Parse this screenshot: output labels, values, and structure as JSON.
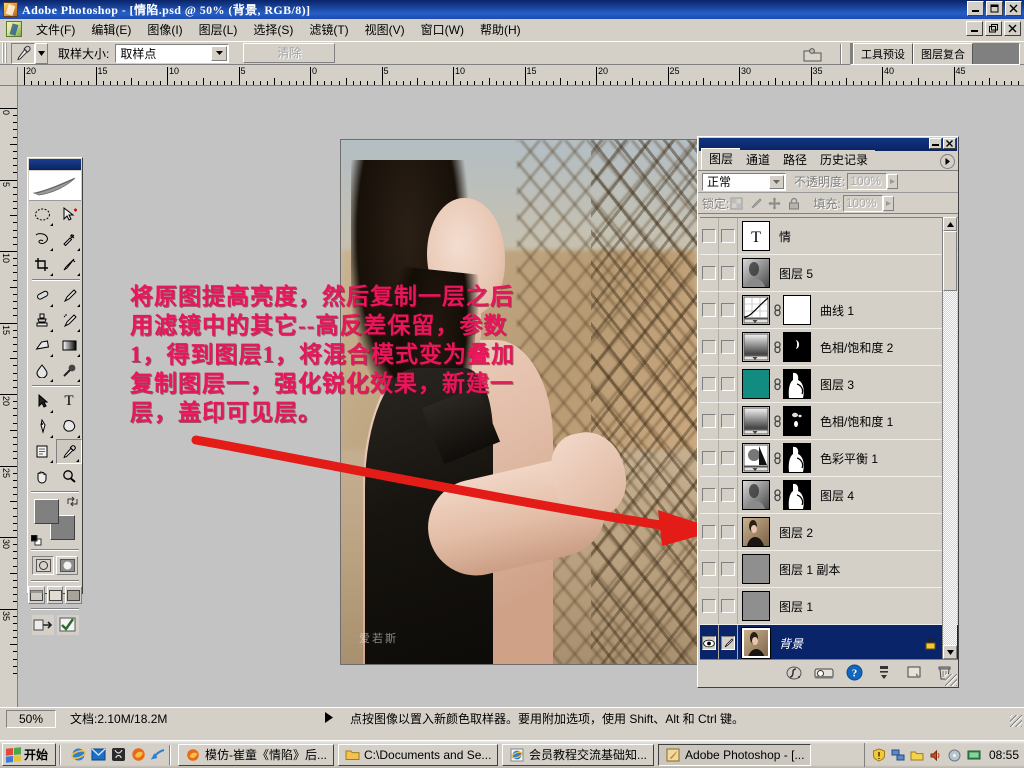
{
  "window": {
    "app_title": "Adobe Photoshop - [情陷.psd @ 50%  (背景,  RGB/8)]",
    "app_icon": "photoshop-icon",
    "minimize": "minimize-icon",
    "maximize": "maximize-icon",
    "close": "close-icon"
  },
  "menubar": {
    "items": [
      {
        "label": "文件(F)"
      },
      {
        "label": "编辑(E)"
      },
      {
        "label": "图像(I)"
      },
      {
        "label": "图层(L)"
      },
      {
        "label": "选择(S)"
      },
      {
        "label": "滤镜(T)"
      },
      {
        "label": "视图(V)"
      },
      {
        "label": "窗口(W)"
      },
      {
        "label": "帮助(H)"
      }
    ]
  },
  "options_bar": {
    "tool_icon": "eyedropper-icon",
    "sample_size_label": "取样大小:",
    "sample_size_value": "取样点",
    "clear_button": "清除",
    "file_browser_icon": "file-browser-icon",
    "palette_well_tabs": [
      "工具预设",
      "图层复合"
    ]
  },
  "rulers": {
    "horizontal_labels": [
      "20",
      "15",
      "10",
      "5",
      "0",
      "5",
      "10",
      "15",
      "20",
      "25",
      "30",
      "35",
      "40",
      "45"
    ],
    "vertical_labels": [
      "0",
      "5",
      "10",
      "15",
      "20",
      "25",
      "30",
      "35"
    ],
    "unit": "cm"
  },
  "toolbox": {
    "tools": [
      {
        "name": "marquee-tool",
        "glyph": "○"
      },
      {
        "name": "move-tool",
        "glyph": "➤"
      },
      {
        "name": "lasso-tool",
        "glyph": "ᗑ"
      },
      {
        "name": "magic-wand-tool",
        "glyph": "✳"
      },
      {
        "name": "crop-tool",
        "glyph": "⌗"
      },
      {
        "name": "slice-tool",
        "glyph": "✄"
      },
      {
        "name": "healing-brush-tool",
        "glyph": "⌁"
      },
      {
        "name": "brush-tool",
        "glyph": "🖌"
      },
      {
        "name": "clone-stamp-tool",
        "glyph": "⎙"
      },
      {
        "name": "history-brush-tool",
        "glyph": "✎"
      },
      {
        "name": "eraser-tool",
        "glyph": "▱"
      },
      {
        "name": "gradient-tool",
        "glyph": "▦"
      },
      {
        "name": "blur-tool",
        "glyph": "💧"
      },
      {
        "name": "dodge-tool",
        "glyph": "🔍"
      },
      {
        "name": "path-selection-tool",
        "glyph": "➚"
      },
      {
        "name": "type-tool",
        "glyph": "T"
      },
      {
        "name": "pen-tool",
        "glyph": "✒"
      },
      {
        "name": "shape-tool",
        "glyph": "◈"
      },
      {
        "name": "notes-tool",
        "glyph": "▤"
      },
      {
        "name": "eyedropper-tool",
        "glyph": "✎"
      },
      {
        "name": "hand-tool",
        "glyph": "✋"
      },
      {
        "name": "zoom-tool",
        "glyph": "🔍"
      }
    ],
    "foreground_color": "#808080",
    "background_color": "#808080",
    "swap_colors_icon": "swap-colors-icon",
    "default_colors_icon": "default-colors-icon"
  },
  "canvas": {
    "document_watermark": "爱若斯",
    "annotation_text": "将原图提高亮度，然后复制一层之后\n用滤镜中的其它--高反差保留，参数\n1，得到图层1，将混合模式变为叠加\n复制图层一，强化锐化效果，新建一\n层，盖印可见层。",
    "annotation_color": "#e8165a",
    "arrow_color": "#e41c18",
    "arrow_name": "red-arrow-annotation"
  },
  "layers_palette": {
    "window_title_icons": [
      "minimize-icon",
      "close-icon"
    ],
    "tabs": [
      {
        "label": "图层",
        "active": true
      },
      {
        "label": "通道",
        "active": false
      },
      {
        "label": "路径",
        "active": false
      },
      {
        "label": "历史记录",
        "active": false
      }
    ],
    "menu_icon": "palette-menu-icon",
    "blend_mode": "正常",
    "opacity_label": "不透明度:",
    "opacity_value": "100%",
    "lock_label": "锁定:",
    "lock_icons": [
      "lock-transparency-icon",
      "lock-image-icon",
      "lock-position-icon",
      "lock-all-icon"
    ],
    "fill_label": "填充:",
    "fill_value": "100%",
    "layers": [
      {
        "name": "情",
        "type": "text",
        "thumb": "text-T",
        "mask": false,
        "selected": false,
        "visible": false
      },
      {
        "name": "图层 5",
        "type": "pixel",
        "thumb": "photo-gray",
        "mask": false,
        "selected": false,
        "visible": false
      },
      {
        "name": "曲线 1",
        "type": "adjustment-curves",
        "thumb": "curves",
        "mask": true,
        "mask_kind": "white",
        "selected": false,
        "visible": false
      },
      {
        "name": "色相/饱和度 2",
        "type": "adjustment-huesat",
        "thumb": "huesat",
        "mask": true,
        "mask_kind": "black-small",
        "selected": false,
        "visible": false
      },
      {
        "name": "图层 3",
        "type": "solid-fill",
        "thumb": "teal",
        "mask": true,
        "mask_kind": "figure",
        "selected": false,
        "visible": false
      },
      {
        "name": "色相/饱和度 1",
        "type": "adjustment-huesat",
        "thumb": "huesat",
        "mask": true,
        "mask_kind": "black-dots",
        "selected": false,
        "visible": false
      },
      {
        "name": "色彩平衡 1",
        "type": "adjustment-colorbalance",
        "thumb": "colorbalance",
        "mask": true,
        "mask_kind": "figure",
        "selected": false,
        "visible": false
      },
      {
        "name": "图层 4",
        "type": "pixel",
        "thumb": "photo-gray",
        "mask": true,
        "mask_kind": "figure",
        "selected": false,
        "visible": false
      },
      {
        "name": "图层 2",
        "type": "pixel",
        "thumb": "photo-color",
        "mask": false,
        "selected": false,
        "visible": false
      },
      {
        "name": "图层 1 副本",
        "type": "pixel",
        "thumb": "flat-gray",
        "mask": false,
        "selected": false,
        "visible": false
      },
      {
        "name": "图层 1",
        "type": "pixel",
        "thumb": "flat-gray",
        "mask": false,
        "selected": false,
        "visible": false
      },
      {
        "name": "背景",
        "type": "background",
        "thumb": "photo-color",
        "mask": false,
        "selected": true,
        "visible": true,
        "locked": true
      }
    ],
    "bottom_buttons": [
      {
        "name": "layer-style-button",
        "glyph": "ƒ"
      },
      {
        "name": "layer-mask-button",
        "glyph": "▭"
      },
      {
        "name": "new-group-button",
        "glyph": "▣"
      },
      {
        "name": "new-adjustment-layer-button",
        "glyph": "◑"
      },
      {
        "name": "new-layer-button",
        "glyph": "❐"
      },
      {
        "name": "delete-layer-button",
        "glyph": "🗑"
      }
    ]
  },
  "status_bar": {
    "zoom": "50%",
    "doc_size": "文档:2.10M/18.2M",
    "expand_icon": "play-arrow-icon",
    "hint": "点按图像以置入新颜色取样器。要用附加选项，使用 Shift、Alt 和 Ctrl 键。"
  },
  "taskbar": {
    "start_label": "开始",
    "quick_launch": [
      {
        "name": "internet-explorer-icon"
      },
      {
        "name": "outlook-express-icon"
      },
      {
        "name": "media-player-icon"
      },
      {
        "name": "firefox-icon"
      },
      {
        "name": "desktop-icon"
      }
    ],
    "tasks": [
      {
        "icon": "firefox-icon",
        "label": "模仿-崔童《情陷》后..."
      },
      {
        "icon": "folder-icon",
        "label": "C:\\Documents and Se..."
      },
      {
        "icon": "internet-explorer-icon",
        "label": "会员教程交流基础知..."
      },
      {
        "icon": "photoshop-icon",
        "label": "Adobe Photoshop - [...",
        "active": true
      }
    ],
    "tray_icons": [
      {
        "name": "shield-warning-icon"
      },
      {
        "name": "network-icon"
      },
      {
        "name": "folder-share-icon"
      },
      {
        "name": "volume-icon"
      },
      {
        "name": "cd-icon"
      },
      {
        "name": "monitor-icon"
      }
    ],
    "clock": "08:55"
  }
}
